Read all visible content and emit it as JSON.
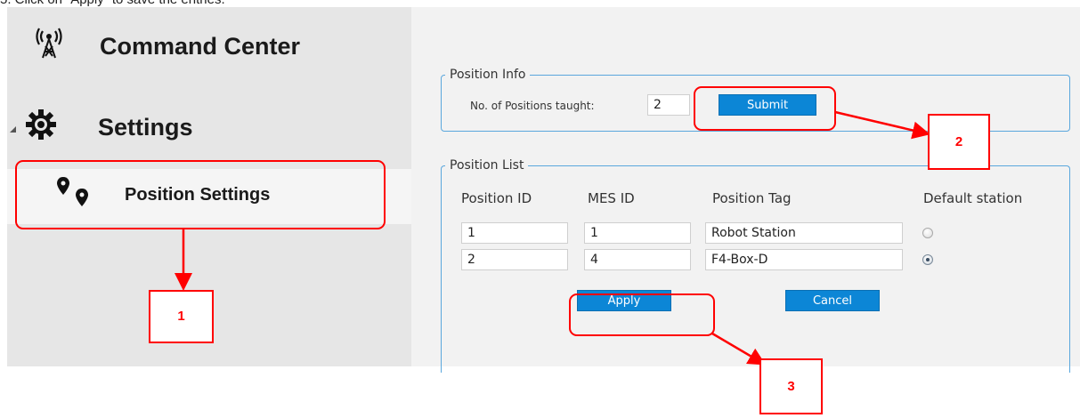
{
  "instruction": "5.   Click on “Apply” to save the entries.",
  "sidebar": {
    "command_center": {
      "label": "Command Center",
      "icon": "antenna-tower-icon"
    },
    "settings": {
      "label": "Settings",
      "icon": "gear-icon"
    },
    "position_settings": {
      "label": "Position Settings",
      "icon": "map-pins-icon"
    }
  },
  "position_info": {
    "legend": "Position Info",
    "count_label": "No. of Positions taught:",
    "count_value": "2",
    "submit_label": "Submit"
  },
  "position_list": {
    "legend": "Position List",
    "columns": [
      "Position ID",
      "MES ID",
      "Position Tag",
      "Default station"
    ],
    "rows": [
      {
        "position_id": "1",
        "mes_id": "1",
        "position_tag": "Robot Station",
        "default": false
      },
      {
        "position_id": "2",
        "mes_id": "4",
        "position_tag": "F4-Box-D",
        "default": true
      }
    ],
    "apply_label": "Apply",
    "cancel_label": "Cancel"
  },
  "annotations": {
    "step1": "1",
    "step2": "2",
    "step3": "3"
  },
  "colors": {
    "highlight": "#ff0000",
    "button": "#0c86d6",
    "fieldset_border": "#5aa7dd"
  }
}
